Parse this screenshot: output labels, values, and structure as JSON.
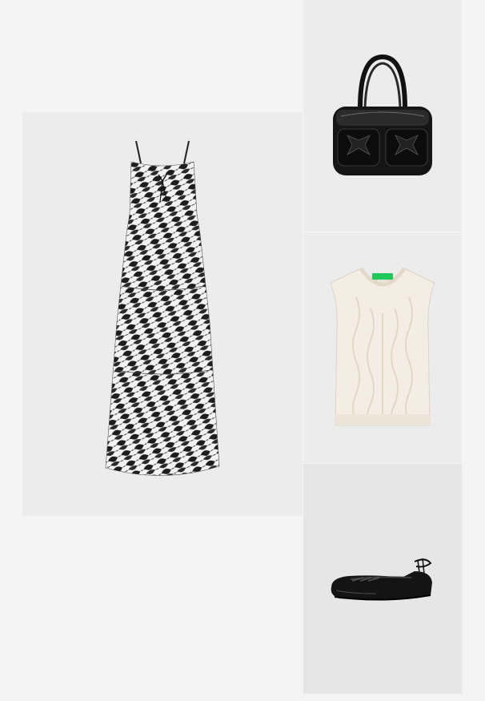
{
  "outfit": {
    "items": [
      {
        "id": "dress",
        "icon": "zebra-print-maxi-dress-icon"
      },
      {
        "id": "bag",
        "icon": "black-leather-shoulder-bag-icon"
      },
      {
        "id": "vest",
        "icon": "cream-cable-knit-vest-icon",
        "tag_color": "#1fc85a"
      },
      {
        "id": "shoe",
        "icon": "black-lace-up-ballet-flat-icon"
      }
    ]
  },
  "colors": {
    "page_bg": "#f4f4f4",
    "tile_bg": "#ececec",
    "shoe_tile_bg": "#e6e6e6",
    "vest_tag": "#1fc85a"
  }
}
